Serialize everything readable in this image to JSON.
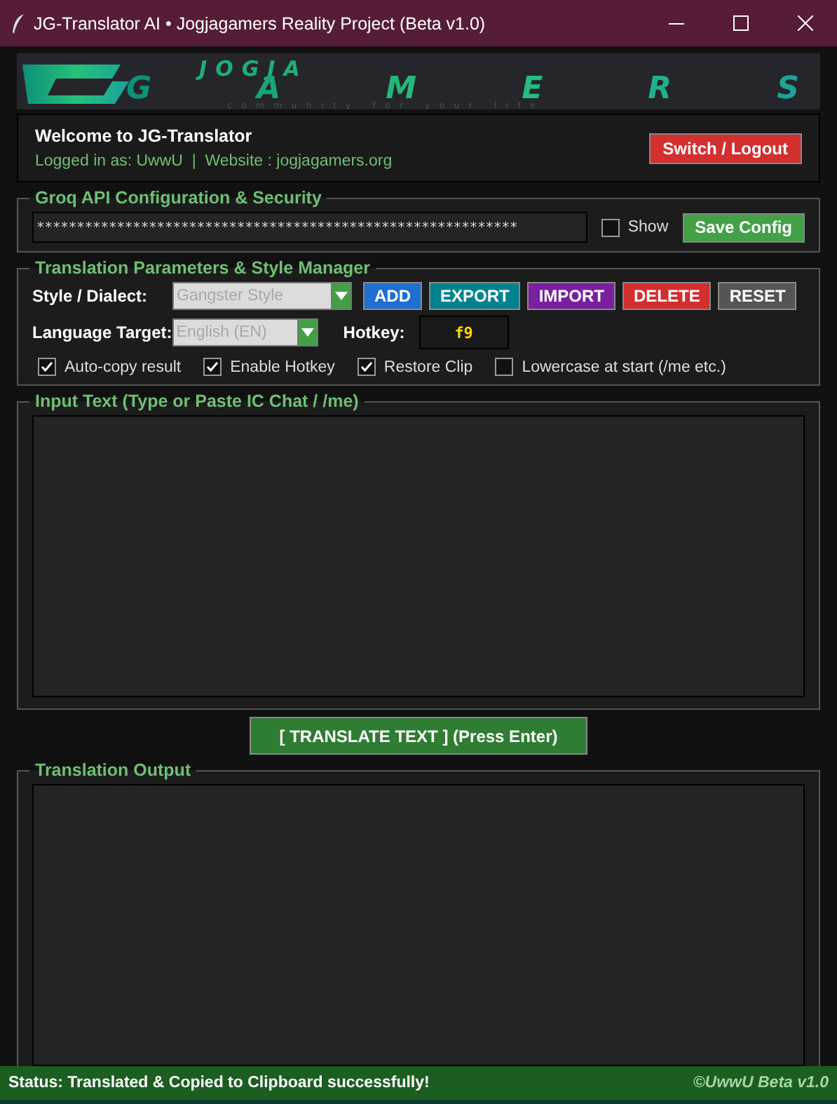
{
  "window": {
    "title": "JG-Translator AI • Jogjagamers Reality Project (Beta v1.0)"
  },
  "banner": {
    "logo_top": "JOGJA",
    "logo_main": "GAMERS",
    "tagline": "community for your life"
  },
  "welcome": {
    "heading": "Welcome to JG-Translator",
    "info": "Logged in as: UwwU  |  Website : jogjagamers.org",
    "button": "Switch / Logout"
  },
  "api_config": {
    "legend": "Groq API Configuration & Security",
    "key_value": "************************************************************",
    "show": {
      "label": "Show",
      "checked": false
    },
    "save_button": "Save Config"
  },
  "parameters": {
    "legend": "Translation Parameters & Style Manager",
    "style_label": "Style / Dialect:",
    "style_value": "Gangster Style",
    "style_buttons": [
      {
        "label": "ADD",
        "color": "#1e6fd0"
      },
      {
        "label": "EXPORT",
        "color": "#00838f"
      },
      {
        "label": "IMPORT",
        "color": "#7b1fa2"
      },
      {
        "label": "DELETE",
        "color": "#d32f2f"
      },
      {
        "label": "RESET",
        "color": "#555555"
      }
    ],
    "language_label": "Language Target:",
    "language_value": "English (EN)",
    "hotkey_label": "Hotkey:",
    "hotkey_value": "f9",
    "options": [
      {
        "label": "Auto-copy result",
        "checked": true
      },
      {
        "label": "Enable Hotkey",
        "checked": true
      },
      {
        "label": "Restore Clip",
        "checked": true
      },
      {
        "label": "Lowercase at start (/me etc.)",
        "checked": false
      }
    ]
  },
  "input": {
    "legend": "Input Text (Type or Paste IC Chat / /me)"
  },
  "translate_button": "[ TRANSLATE TEXT ] (Press Enter)",
  "output": {
    "legend": "Translation Output"
  },
  "status_bar": {
    "status": "Status: Translated & Copied to Clipboard successfully!",
    "credit": "©UwwU Beta v1.0"
  }
}
